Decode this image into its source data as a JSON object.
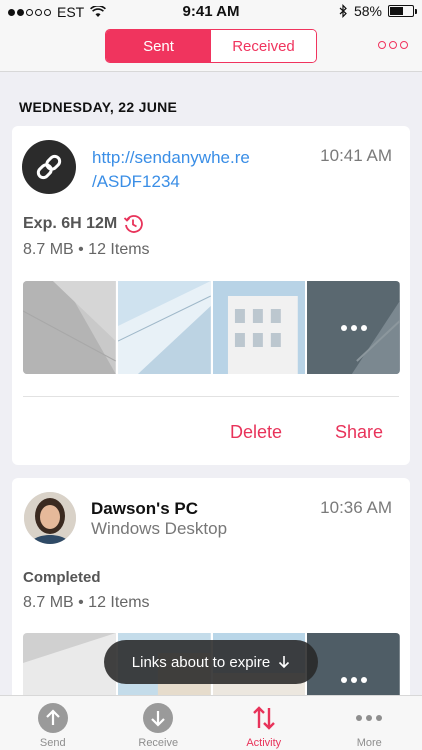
{
  "status_bar": {
    "carrier": "EST",
    "time": "9:41 AM",
    "battery": "58%"
  },
  "segmented": {
    "sent": "Sent",
    "received": "Received"
  },
  "date_header": "WEDNESDAY, 22 JUNE",
  "transfers": [
    {
      "url_line1": "http://sendanywhe.re",
      "url_line2": "/ASDF1234",
      "time": "10:41 AM",
      "expiry": "Exp. 6H 12M",
      "meta": "8.7 MB • 12 Items",
      "delete_label": "Delete",
      "share_label": "Share"
    },
    {
      "device_name": "Dawson's PC",
      "device_type": "Windows Desktop",
      "time": "10:36 AM",
      "status": "Completed",
      "meta": "8.7 MB • 12 Items"
    }
  ],
  "toast": {
    "text": "Links about to expire"
  },
  "tabs": [
    {
      "label": "Send",
      "icon": "send-icon"
    },
    {
      "label": "Receive",
      "icon": "receive-icon"
    },
    {
      "label": "Activity",
      "icon": "activity-icon"
    },
    {
      "label": "More",
      "icon": "more-icon"
    }
  ],
  "colors": {
    "accent": "#f0345e",
    "link": "#3a8ee6"
  }
}
